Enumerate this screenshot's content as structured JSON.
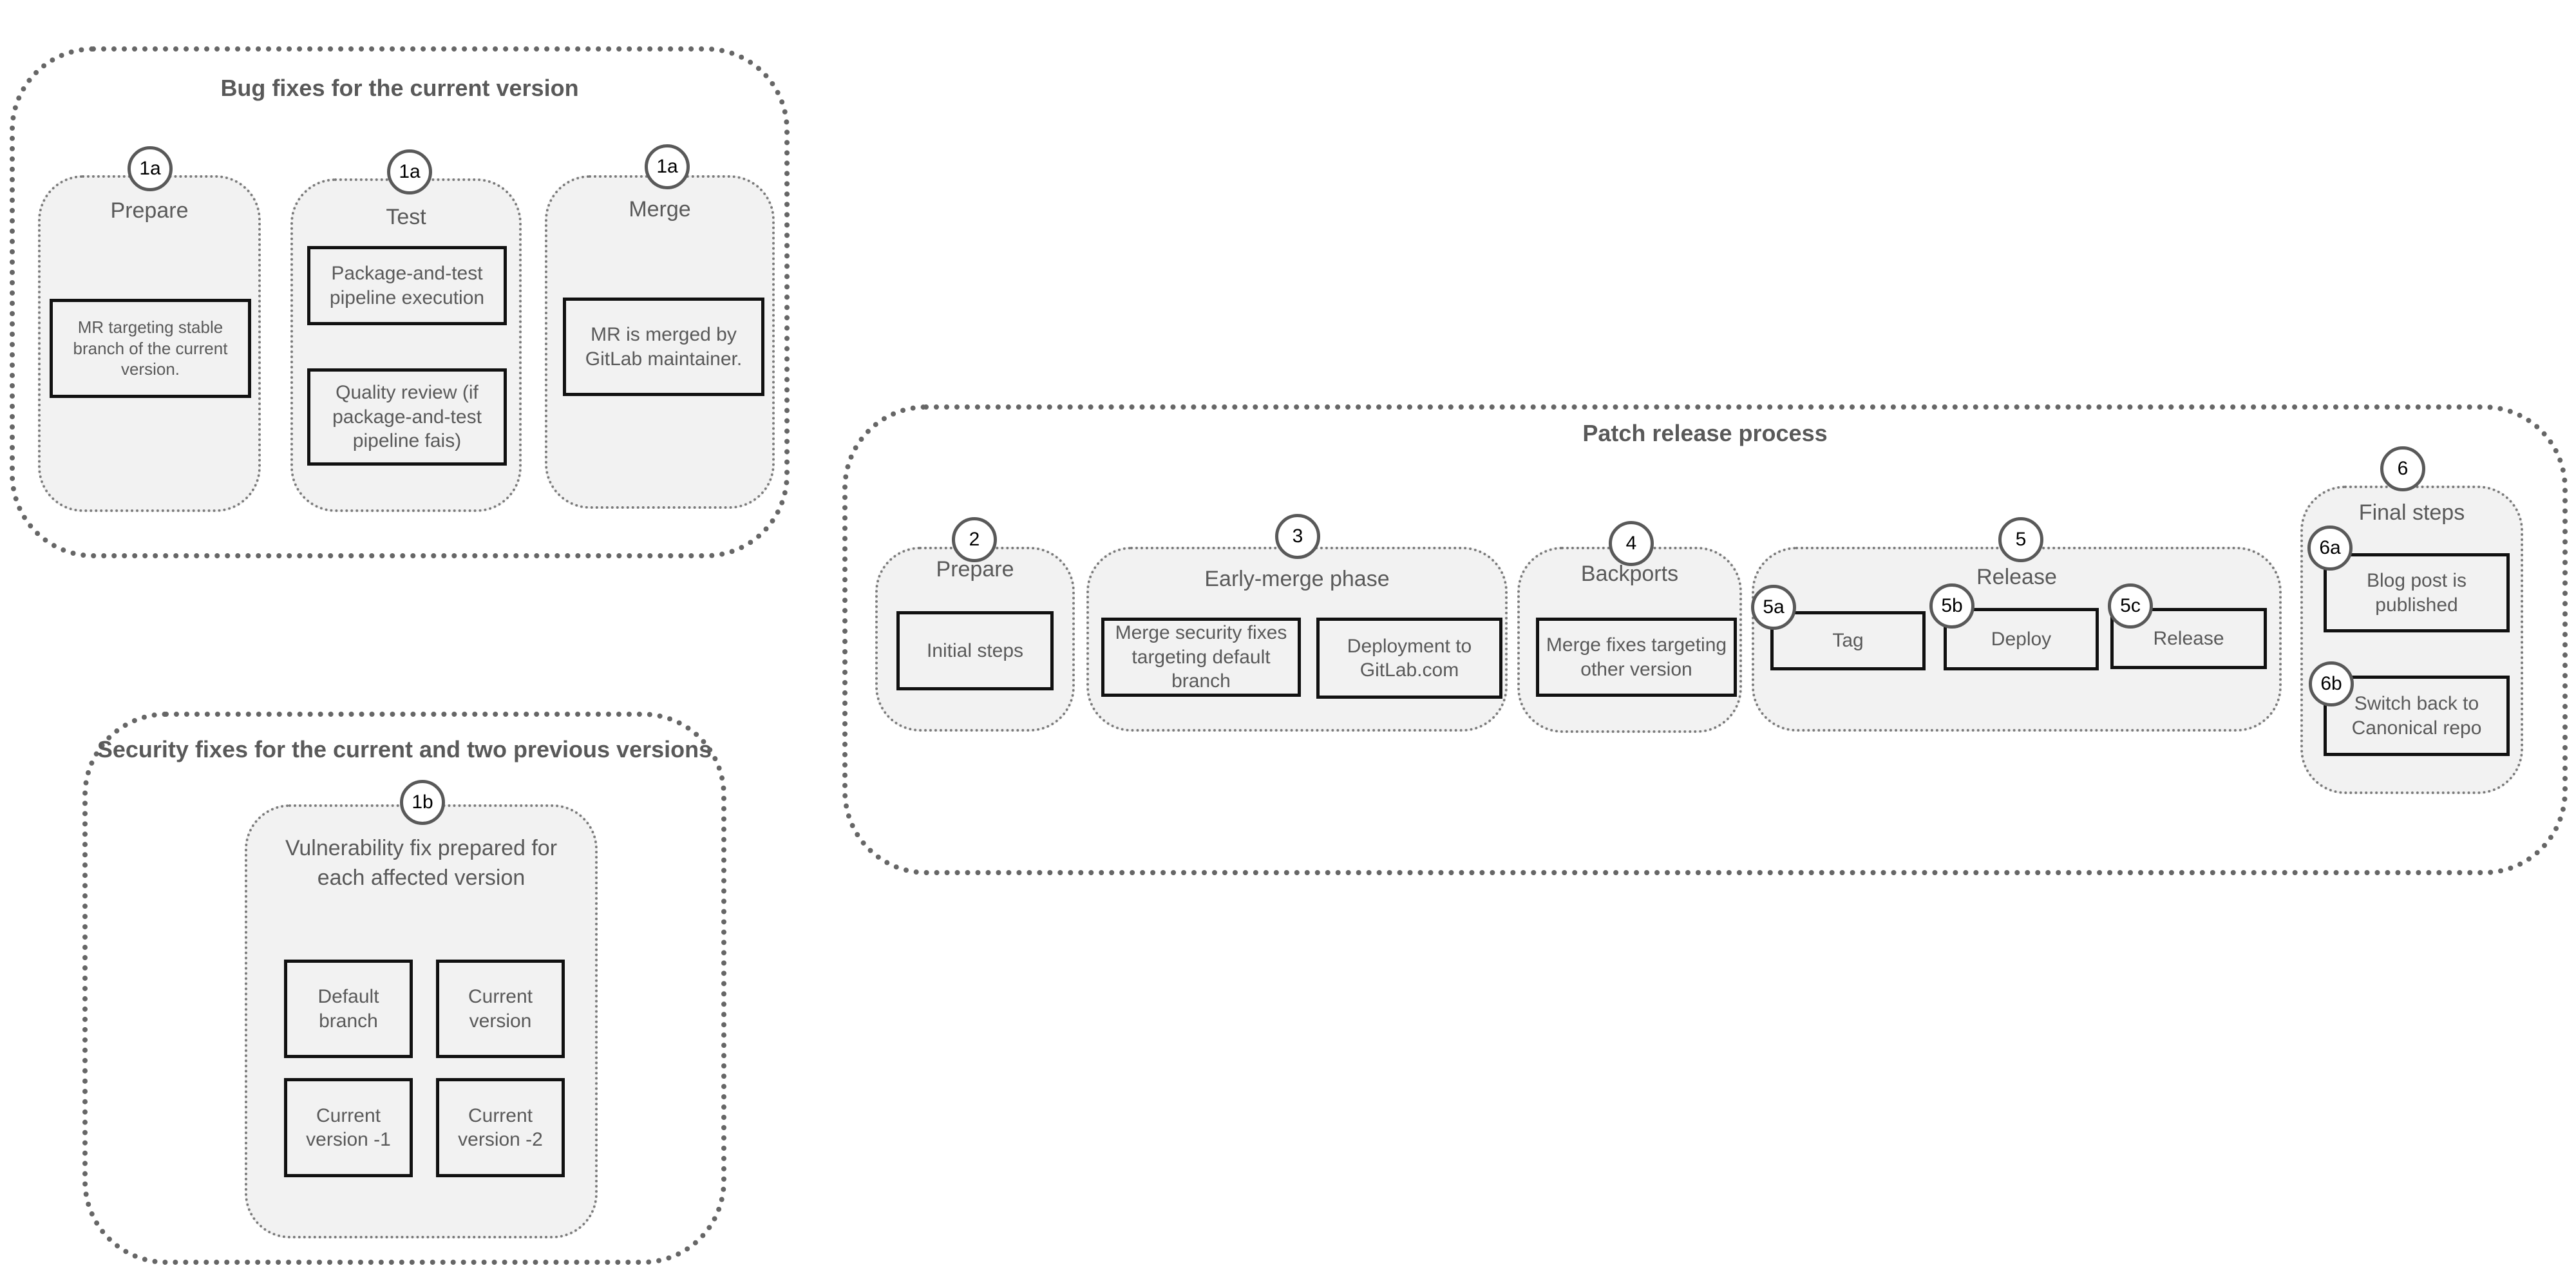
{
  "bug_fixes": {
    "title": "Bug fixes for the current version",
    "groups": [
      {
        "badge": "1a",
        "label": "Prepare",
        "boxes": [
          "MR targeting stable branch of the current version."
        ]
      },
      {
        "badge": "1a",
        "label": "Test",
        "boxes": [
          "Package-and-test pipeline execution",
          "Quality review (if package-and-test pipeline fais)"
        ]
      },
      {
        "badge": "1a",
        "label": "Merge",
        "boxes": [
          "MR is merged by GitLab maintainer."
        ]
      }
    ]
  },
  "security_fixes": {
    "title": "Security fixes for the current and two previous versions",
    "group": {
      "badge": "1b",
      "label_line1": "Vulnerability fix prepared for",
      "label_line2": "each affected version",
      "boxes": [
        "Default branch",
        "Current version",
        "Current version -1",
        "Current version -2"
      ]
    }
  },
  "patch_release": {
    "title": "Patch release process",
    "groups": [
      {
        "badge": "2",
        "label": "Prepare",
        "boxes": [
          "Initial steps"
        ]
      },
      {
        "badge": "3",
        "label": "Early-merge phase",
        "boxes": [
          "Merge security fixes targeting default branch",
          "Deployment to GitLab.com"
        ]
      },
      {
        "badge": "4",
        "label": "Backports",
        "boxes": [
          "Merge fixes targeting other version"
        ]
      },
      {
        "badge": "5",
        "label": "Release",
        "boxes": [
          {
            "badge": "5a",
            "label": "Tag"
          },
          {
            "badge": "5b",
            "label": "Deploy"
          },
          {
            "badge": "5c",
            "label": "Release"
          }
        ]
      },
      {
        "badge": "6",
        "label": "Final steps",
        "boxes": [
          {
            "badge": "6a",
            "label": "Blog post is published"
          },
          {
            "badge": "6b",
            "label": "Switch back to Canonical repo"
          }
        ]
      }
    ]
  }
}
